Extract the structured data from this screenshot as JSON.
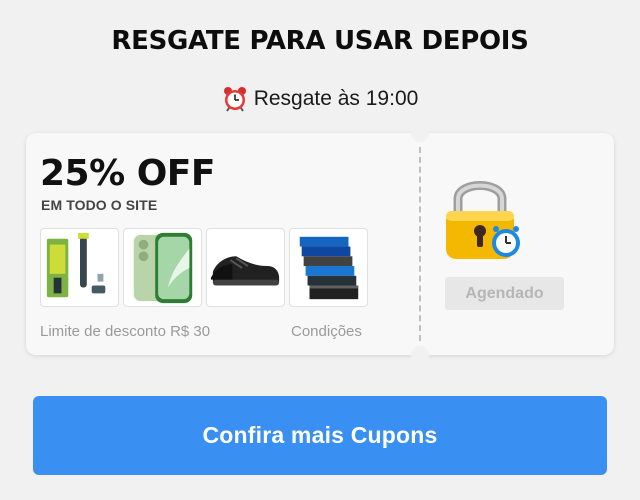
{
  "header": {
    "title": "RESGATE PARA USAR DEPOIS",
    "schedule_text": "Resgate às 19:00",
    "schedule_icon": "alarm-clock-icon"
  },
  "coupon": {
    "discount": "25% OFF",
    "scope": "EM TODO O SITE",
    "products": [
      {
        "icon": "trimmer-product-image"
      },
      {
        "icon": "smartphone-product-image"
      },
      {
        "icon": "sneaker-product-image"
      },
      {
        "icon": "underwear-pack-product-image"
      }
    ],
    "limit_text": "Limite de desconto R$ 30",
    "conditions_label": "Condições",
    "status_icon": "lock-with-clock-icon",
    "status_label": "Agendado"
  },
  "cta": {
    "label": "Confira mais Cupons",
    "color": "#3a8ff3"
  },
  "colors": {
    "background": "#f1f1f1",
    "card": "#f8f8f8",
    "muted_text": "#9a9a9a",
    "disabled_button": "#e7e7e7"
  }
}
